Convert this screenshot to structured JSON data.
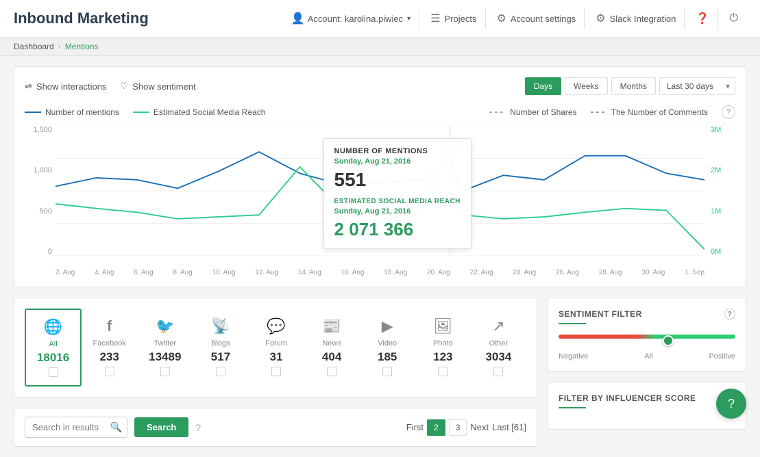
{
  "app": {
    "title": "Inbound Marketing"
  },
  "header": {
    "account_label": "Account: karolina.piwiec",
    "projects_label": "Projects",
    "account_settings_label": "Account settings",
    "slack_label": "Slack Integration"
  },
  "breadcrumb": {
    "home": "Dashboard",
    "current": "Mentions"
  },
  "toolbar": {
    "show_interactions": "Show interactions",
    "show_sentiment": "Show sentiment",
    "days_btn": "Days",
    "weeks_btn": "Weeks",
    "months_btn": "Months",
    "date_range": "Last 30 days"
  },
  "chart": {
    "legend": [
      {
        "label": "Number of mentions",
        "type": "blue"
      },
      {
        "label": "Estimated Social Media Reach",
        "type": "green"
      },
      {
        "label": "Number of Shares",
        "type": "dash"
      },
      {
        "label": "The Number of Comments",
        "type": "dash2"
      }
    ],
    "y_left": [
      "1,500",
      "1,000",
      "500",
      "0"
    ],
    "y_right": [
      "3M",
      "2M",
      "1M",
      "0M"
    ],
    "x_labels": [
      "2. Aug",
      "4. Aug",
      "6. Aug",
      "8. Aug",
      "10. Aug",
      "12. Aug",
      "14. Aug",
      "16. Aug",
      "18. Aug",
      "20. Aug",
      "22. Aug",
      "24. Aug",
      "26. Aug",
      "28. Aug",
      "30. Aug",
      "1. Sep"
    ],
    "tooltip": {
      "title": "NUMBER OF MENTIONS",
      "date": "Sunday, Aug 21, 2016",
      "value": "551",
      "subtitle": "ESTIMATED SOCIAL MEDIA REACH",
      "date2": "Sunday, Aug 21, 2016",
      "value2": "2 071 366"
    }
  },
  "sources": [
    {
      "name": "All",
      "count": "18016",
      "icon": "🌐",
      "active": true
    },
    {
      "name": "Facebook",
      "count": "233",
      "icon": "f",
      "active": false
    },
    {
      "name": "Twitter",
      "count": "13489",
      "icon": "🐦",
      "active": false
    },
    {
      "name": "Blogs",
      "count": "517",
      "icon": "📡",
      "active": false
    },
    {
      "name": "Forum",
      "count": "31",
      "icon": "💬",
      "active": false
    },
    {
      "name": "News",
      "count": "404",
      "icon": "📰",
      "active": false
    },
    {
      "name": "Video",
      "count": "185",
      "icon": "▶",
      "active": false
    },
    {
      "name": "Photo",
      "count": "123",
      "icon": "🖼",
      "active": false
    },
    {
      "name": "Other",
      "count": "3034",
      "icon": "↗",
      "active": false
    }
  ],
  "search": {
    "placeholder": "Search in results",
    "button_label": "Search",
    "help": "?"
  },
  "pagination": {
    "first": "First",
    "prev_dots": "",
    "page1": "2",
    "page2": "3",
    "next": "Next",
    "last": "Last [61]",
    "active_page": "2"
  },
  "sentiment_panel": {
    "title": "SENTIMENT FILTER",
    "negative": "Negative",
    "all": "All",
    "positive": "Positive",
    "help": "?"
  },
  "influencer_panel": {
    "title": "FILTER BY INFLUENCER SCORE",
    "help": "?"
  }
}
